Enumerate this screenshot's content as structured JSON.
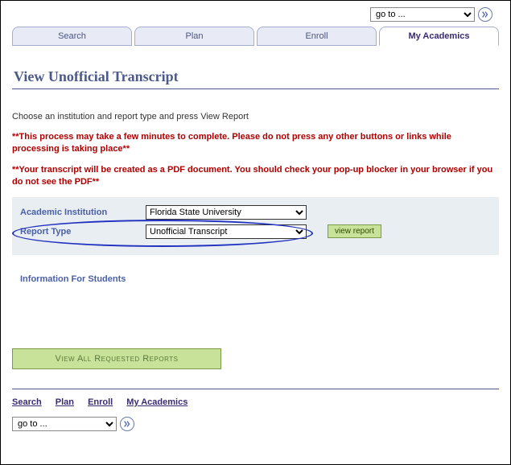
{
  "topNav": {
    "goto": "go to ..."
  },
  "tabs": [
    {
      "label": "Search"
    },
    {
      "label": "Plan"
    },
    {
      "label": "Enroll"
    },
    {
      "label": "My Academics"
    }
  ],
  "activeTabIndex": 3,
  "pageTitle": "View Unofficial Transcript",
  "instruction": "Choose an institution and report type and press View Report",
  "warning1": "**This process may take a few minutes to complete. Please do not press any other buttons or links while processing is taking place**",
  "warning2": "**Your transcript will be created as a PDF document. You should check your pop-up blocker in your browser if you do not see the PDF**",
  "form": {
    "institutionLabel": "Academic Institution",
    "institutionValue": "Florida State University",
    "reportTypeLabel": "Report Type",
    "reportTypeValue": "Unofficial Transcript",
    "viewReportLabel": "view report"
  },
  "infoLink": "Information For Students",
  "viewAllLabel": "View All Requested Reports",
  "footerLinks": [
    {
      "label": "Search"
    },
    {
      "label": "Plan"
    },
    {
      "label": "Enroll"
    },
    {
      "label": "My Academics"
    }
  ],
  "bottomNav": {
    "goto": "go to ..."
  }
}
